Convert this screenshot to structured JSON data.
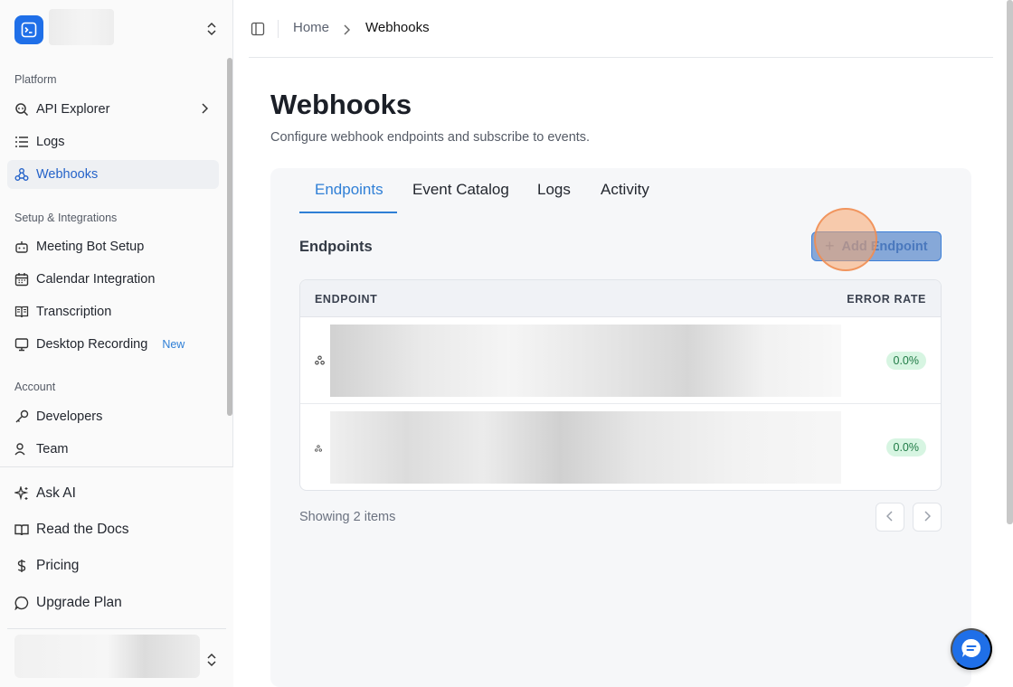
{
  "sidebar": {
    "sections": {
      "platform": "Platform",
      "setup": "Setup & Integrations",
      "account": "Account"
    },
    "items": {
      "api_explorer": "API Explorer",
      "logs": "Logs",
      "webhooks": "Webhooks",
      "meeting_bot": "Meeting Bot Setup",
      "calendar": "Calendar Integration",
      "transcription": "Transcription",
      "desktop_recording": "Desktop Recording",
      "desktop_badge": "New",
      "developers": "Developers",
      "team": "Team"
    },
    "bottom": {
      "ask_ai": "Ask AI",
      "docs": "Read the Docs",
      "pricing": "Pricing",
      "upgrade": "Upgrade Plan"
    }
  },
  "breadcrumb": {
    "home": "Home",
    "current": "Webhooks"
  },
  "page": {
    "title": "Webhooks",
    "subtitle": "Configure webhook endpoints and subscribe to events."
  },
  "tabs": [
    "Endpoints",
    "Event Catalog",
    "Logs",
    "Activity"
  ],
  "endpoints": {
    "heading": "Endpoints",
    "add_button": "Add Endpoint",
    "columns": {
      "endpoint": "ENDPOINT",
      "error_rate": "ERROR RATE"
    },
    "rows": [
      {
        "error_rate": "0.0%"
      },
      {
        "error_rate": "0.0%"
      }
    ],
    "showing": "Showing 2 items"
  },
  "colors": {
    "accent": "#2f7fd6",
    "brand": "#1f6fe8",
    "success_bg": "#d7f5e2"
  }
}
